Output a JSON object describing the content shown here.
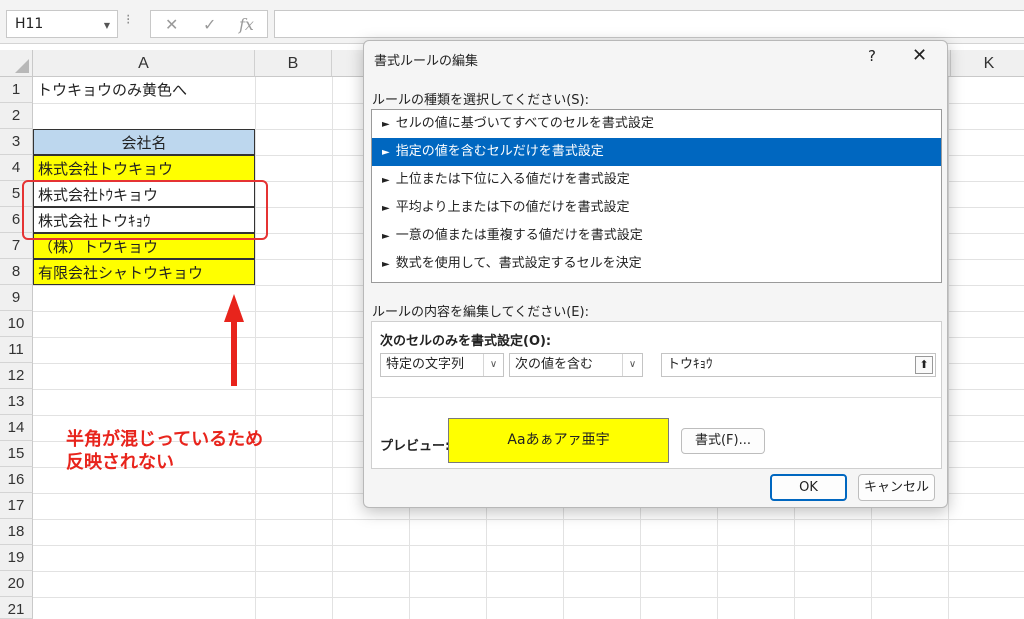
{
  "formula_bar": {
    "name_box": "H11",
    "cancel_glyph": "✕",
    "enter_glyph": "✓",
    "fx_glyph": "fx",
    "formula": ""
  },
  "columns": [
    "A",
    "B",
    "K"
  ],
  "rows": [
    "1",
    "2",
    "3",
    "4",
    "5",
    "6",
    "7",
    "8",
    "9",
    "10",
    "11",
    "12",
    "13",
    "14",
    "15",
    "16",
    "17",
    "18",
    "19",
    "20",
    "21"
  ],
  "cells": {
    "a1": "トウキョウのみ黄色へ",
    "a3": "会社名",
    "a4": "株式会社トウキョウ",
    "a5": "株式会社ﾄｳキョウ",
    "a6": "株式会社トウｷｮｳ",
    "a7": "（株）トウキョウ",
    "a8": "有限会社シャトウキョウ"
  },
  "annotation": {
    "line1": "半角が混じっているため",
    "line2": "反映されない"
  },
  "dialog": {
    "title": "書式ルールの編集",
    "help": "?",
    "close": "✕",
    "rule_type_label": "ルールの種類を選択してください(S):",
    "rule_types": [
      "セルの値に基づいてすべてのセルを書式設定",
      "指定の値を含むセルだけを書式設定",
      "上位または下位に入る値だけを書式設定",
      "平均より上または下の値だけを書式設定",
      "一意の値または重複する値だけを書式設定",
      "数式を使用して、書式設定するセルを決定"
    ],
    "selected_rule_index": 1,
    "edit_label": "ルールの内容を編集してください(E):",
    "format_only_label": "次のセルのみを書式設定(O):",
    "condition_type": "特定の文字列",
    "condition_operator": "次の値を含む",
    "condition_value": "トウｷｮｳ",
    "preview_label": "プレビュー:",
    "preview_text": "Aaあぁアァ亜宇",
    "preview_fill": "#ffff00",
    "format_button": "書式(F)...",
    "ok_button": "OK",
    "cancel_button": "キャンセル"
  },
  "colors": {
    "highlight": "#ffff00",
    "header_fill": "#bdd7ee",
    "selection": "#0067c0",
    "annotation_red": "#e8241c"
  }
}
